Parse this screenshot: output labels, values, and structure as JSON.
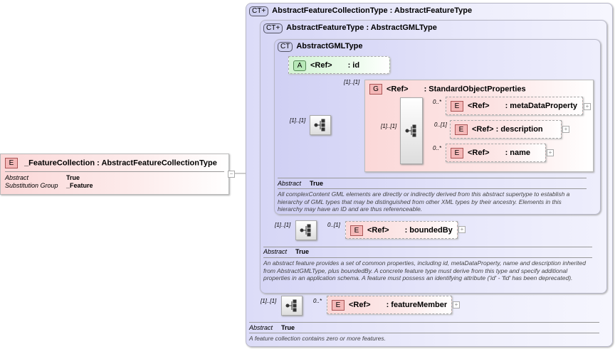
{
  "root": {
    "badge": "E",
    "name": "_FeatureCollection",
    "type": ": AbstractFeatureCollectionType",
    "props": [
      {
        "k": "Abstract",
        "v": "True"
      },
      {
        "k": "Substitution Group",
        "v": "_Feature"
      }
    ],
    "toggle": "−"
  },
  "ct1": {
    "badge": "CT+",
    "title": "AbstractFeatureCollectionType : AbstractFeatureType",
    "abstract_k": "Abstract",
    "abstract_v": "True",
    "doc": "A feature collection contains zero or more features."
  },
  "ct2": {
    "badge": "CT+",
    "title": "AbstractFeatureType : AbstractGMLType",
    "abstract_k": "Abstract",
    "abstract_v": "True",
    "doc": "An abstract feature provides a set of common properties, including id, metaDataProperty, name and description inherited from AbstractGMLType, plus boundedBy.    A concrete feature type must derive from this type and specify additional  properties in an application schema. A feature must possess an identifying attribute ('id' - 'fid' has been deprecated)."
  },
  "ct3": {
    "badge": "CT",
    "title": "AbstractGMLType",
    "abstract_k": "Abstract",
    "abstract_v": "True",
    "doc": "All complexContent GML elements are directly or indirectly derived from this abstract supertype to establish a hierarchy of GML types that may be distinguished from other XML types by their ancestry. Elements in this hierarchy may have an ID and are thus referenceable."
  },
  "attr_id": {
    "badge": "A",
    "ref": "<Ref>",
    "name": ": id"
  },
  "group": {
    "badge": "G",
    "ref": "<Ref>",
    "name": ": StandardObjectProperties",
    "card": "[1]..[1]"
  },
  "seq_cards": {
    "gml": "[1]..[1]",
    "group_inner": "[1]..[1]",
    "feature": "[1]..[1]",
    "collection": "[1]..[1]"
  },
  "elements": [
    {
      "badge": "E",
      "ref": "<Ref>",
      "name": ": metaDataProperty",
      "card": "0..*",
      "toggle": "+"
    },
    {
      "badge": "E",
      "ref": "<Ref>",
      "name": ": description",
      "card": "0..[1]",
      "toggle": "+"
    },
    {
      "badge": "E",
      "ref": "<Ref>",
      "name": ": name",
      "card": "0..*",
      "toggle": "+"
    },
    {
      "badge": "E",
      "ref": "<Ref>",
      "name": ": boundedBy",
      "card": "0..[1]",
      "toggle": "+"
    },
    {
      "badge": "E",
      "ref": "<Ref>",
      "name": ": featureMember",
      "card": "0..*",
      "toggle": "+"
    }
  ]
}
